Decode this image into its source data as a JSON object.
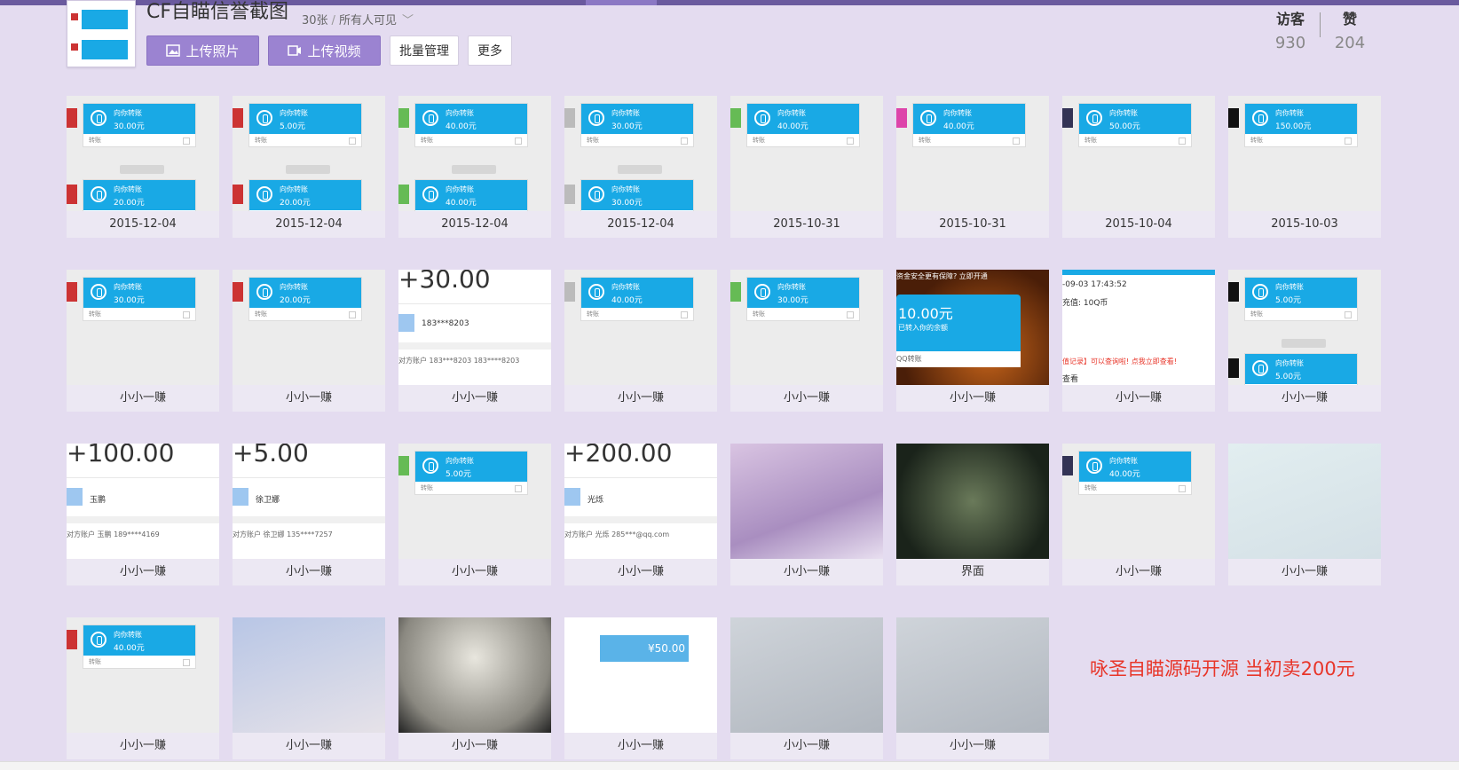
{
  "album": {
    "title": "CF自瞄信誉截图",
    "count": "30张",
    "visibility": "所有人可见"
  },
  "toolbar": {
    "upload_photo": "上传照片",
    "upload_video": "上传视频",
    "batch_manage": "批量管理",
    "more": "更多"
  },
  "stats": {
    "visitors_label": "访客",
    "visitors_value": "930",
    "likes_label": "赞",
    "likes_value": "204"
  },
  "transfer": {
    "title": "向你转账",
    "note": "转账"
  },
  "photos": [
    {
      "caption": "2015-12-04",
      "amounts": [
        "30.00元",
        "20.00元"
      ]
    },
    {
      "caption": "2015-12-04",
      "amounts": [
        "5.00元",
        "20.00元"
      ]
    },
    {
      "caption": "2015-12-04",
      "amounts": [
        "40.00元",
        "40.00元"
      ]
    },
    {
      "caption": "2015-12-04",
      "amounts": [
        "30.00元",
        "30.00元"
      ]
    },
    {
      "caption": "2015-10-31",
      "amounts": [
        "40.00元"
      ]
    },
    {
      "caption": "2015-10-31",
      "amounts": [
        "40.00元"
      ]
    },
    {
      "caption": "2015-10-04",
      "amounts": [
        "50.00元"
      ]
    },
    {
      "caption": "2015-10-03",
      "amounts": [
        "150.00元"
      ]
    },
    {
      "caption": "小小一赚",
      "amounts": [
        "30.00元"
      ]
    },
    {
      "caption": "小小一赚",
      "amounts": [
        "20.00元"
      ]
    },
    {
      "caption": "小小一赚",
      "pay_amount": "+30.00",
      "pay_name": "183***8203",
      "pay_account": "对方账户    183***8203 183****8203"
    },
    {
      "caption": "小小一赚",
      "amounts": [
        "40.00元"
      ]
    },
    {
      "caption": "小小一赚",
      "amounts": [
        "30.00元"
      ]
    },
    {
      "caption": "小小一赚",
      "banner": "资金安全更有保障? 立即开通",
      "big_amount": "10.00元",
      "big_sub": "已转入你的余额",
      "small": "QQ转账"
    },
    {
      "caption": "小小一赚",
      "time": "-09-03 17:43:52",
      "recharge": "充值: 10Q币",
      "footer_note": "值记录】可以查询啦! 点我立即查看!",
      "footer_view": "查看"
    },
    {
      "caption": "小小一赚",
      "amounts": [
        "5.00元",
        "5.00元"
      ]
    },
    {
      "caption": "小小一赚",
      "pay_amount": "+100.00",
      "pay_name": "玉鹏",
      "pay_account": "对方账户    玉鹏 189****4169"
    },
    {
      "caption": "小小一赚",
      "pay_amount": "+5.00",
      "pay_name": "徐卫娜",
      "pay_account": "对方账户    徐卫娜 135****7257"
    },
    {
      "caption": "小小一赚",
      "amounts": [
        "5.00元"
      ]
    },
    {
      "caption": "小小一赚",
      "pay_amount": "+200.00",
      "pay_name": "光烁",
      "pay_account": "对方账户    光烁 285***@qq.com"
    },
    {
      "caption": "小小一赚"
    },
    {
      "caption": "界面"
    },
    {
      "caption": "小小一赚",
      "amounts": [
        "40.00元"
      ]
    },
    {
      "caption": "小小一赚"
    },
    {
      "caption": "小小一赚",
      "amounts": [
        "40.00元"
      ]
    },
    {
      "caption": "小小一赚"
    },
    {
      "caption": "小小一赚"
    },
    {
      "caption": "小小一赚",
      "wallet_amount": "¥50.00"
    },
    {
      "caption": "小小一赚"
    },
    {
      "caption": "小小一赚"
    }
  ],
  "promo_text": "咏圣自瞄源码开源   当初卖200元",
  "colors": {
    "background": "#e4dcf0",
    "button_purple": "#9b83d1",
    "transfer_blue": "#19a9e5",
    "promo_red": "#e8362a"
  }
}
